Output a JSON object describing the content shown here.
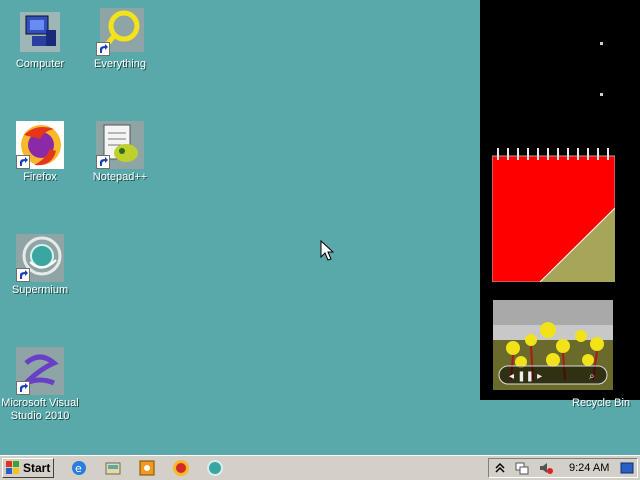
{
  "desktop": {
    "icons": [
      {
        "label": "Computer"
      },
      {
        "label": "Everything"
      },
      {
        "label": "Firefox"
      },
      {
        "label": "Notepad++"
      },
      {
        "label": "Supermium"
      },
      {
        "label": "Microsoft Visual Studio 2010"
      }
    ],
    "recycle_bin_label": "Recycle Bin"
  },
  "taskbar": {
    "start_label": "Start",
    "clock": "9:24 AM"
  },
  "colors": {
    "desktop_bg": "#5aa9aa",
    "taskbar_bg": "#d4d0c8",
    "sidebar_bg": "#000000"
  }
}
